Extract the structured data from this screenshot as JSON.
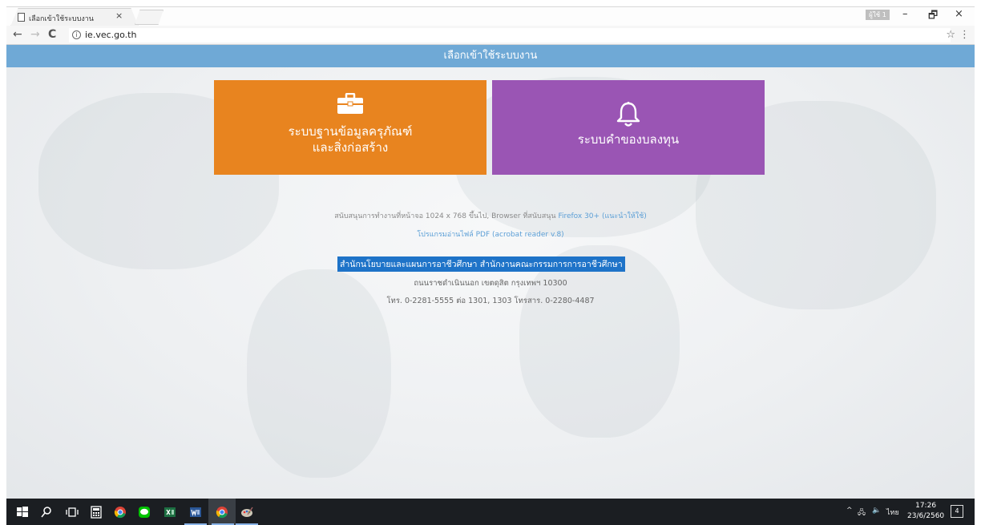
{
  "browser": {
    "tab_title": "เลือกเข้าใช้ระบบงาน",
    "tab_close": "×",
    "window_user": "ผู้ใช้ 1",
    "window_controls": {
      "minimize": "–",
      "restore": "🗗",
      "close": "×"
    },
    "nav": {
      "back": "←",
      "forward": "→",
      "reload": "C"
    },
    "info_icon": "i",
    "url": "ie.vec.go.th",
    "bookmark_star": "☆",
    "menu": "⋮"
  },
  "page": {
    "header_title": "เลือกเข้าใช้ระบบงาน",
    "tiles": [
      {
        "icon": "briefcase-icon",
        "label_line1": "ระบบฐานข้อมูลครุภัณฑ์",
        "label_line2": "และสิ่งก่อสร้าง",
        "color": "#e8841f"
      },
      {
        "icon": "bell-icon",
        "label_line1": "ระบบคำของบลงทุน",
        "color": "#9a55b4"
      }
    ],
    "support_note": {
      "prefix": "สนับสนุนการทำงานที่หน้าจอ 1024 x 768 ขึ้นไป, Browser ที่สนับสนุน",
      "browser_link": "Firefox 30+ (แนะนำให้ใช้)",
      "pdf_link": "โปรแกรมอ่านไฟล์ PDF (acrobat reader v.8)"
    },
    "agency_name": "สำนักนโยบายและแผนการอาชีวศึกษา สำนักงานคณะกรรมการการอาชีวศึกษา",
    "address": "ถนนราชดำเนินนอก เขตดุสิต กรุงเทพฯ 10300",
    "phone": "โทร. 0-2281-5555 ต่อ 1301, 1303 โทรสาร. 0-2280-4487"
  },
  "taskbar": {
    "items": [
      "windows-start-icon",
      "search-icon",
      "task-view-icon",
      "calculator-icon",
      "chrome-icon",
      "line-icon",
      "excel-icon",
      "word-icon",
      "chrome-icon",
      "paint-icon"
    ],
    "tray": {
      "chevron": "^",
      "network": "🖧",
      "volume": "🔈",
      "language": "ไทย"
    },
    "time": "17:26",
    "date": "23/6/2560",
    "notifications": "4"
  }
}
